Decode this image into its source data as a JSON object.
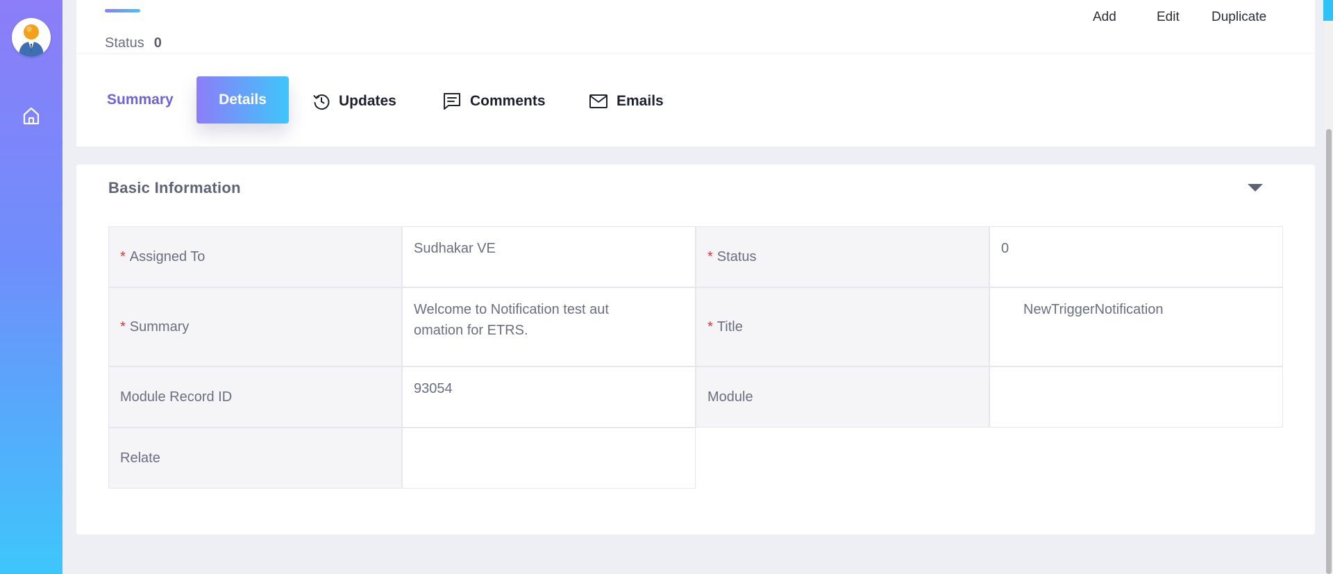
{
  "colors": {
    "accent_purple": "#8c7df8",
    "accent_blue": "#3ec6fb",
    "required_red": "#e03030"
  },
  "sidebar": {
    "avatar_icon": "user-avatar",
    "home_icon": "home-icon"
  },
  "header": {
    "status_label": "Status",
    "status_value": "0",
    "actions": [
      "Add",
      "Edit",
      "Duplicate"
    ]
  },
  "tabs": [
    {
      "label": "Summary",
      "icon": "",
      "active": false
    },
    {
      "label": "Details",
      "icon": "",
      "active": true
    },
    {
      "label": "Updates",
      "icon": "history-icon",
      "active": false
    },
    {
      "label": "Comments",
      "icon": "comment-icon",
      "active": false
    },
    {
      "label": "Emails",
      "icon": "envelope-icon",
      "active": false
    }
  ],
  "section": {
    "title": "Basic Information",
    "collapse_icon": "caret-down-icon"
  },
  "fields": {
    "assigned_to": {
      "label": "Assigned To",
      "required": true,
      "value": "Sudhakar VE"
    },
    "status": {
      "label": "Status",
      "required": true,
      "value": "0"
    },
    "summary": {
      "label": "Summary",
      "required": true,
      "value": "Welcome to Notification test aut omation for ETRS."
    },
    "title": {
      "label": "Title",
      "required": true,
      "value": "NewTriggerNotification"
    },
    "module_record_id": {
      "label": "Module Record ID",
      "required": false,
      "value": "93054"
    },
    "module": {
      "label": "Module",
      "required": false,
      "value": ""
    },
    "relate": {
      "label": "Relate",
      "required": false,
      "value": ""
    }
  },
  "required_marker": "*"
}
